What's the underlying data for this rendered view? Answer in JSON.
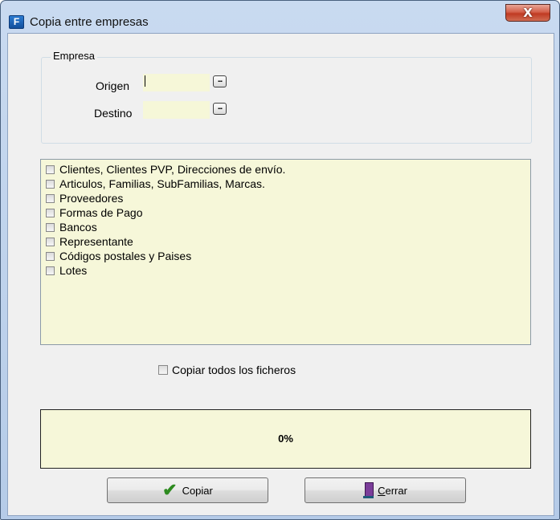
{
  "window": {
    "title": "Copia entre empresas",
    "close_glyph": "X",
    "app_icon_glyph": "F"
  },
  "empresa": {
    "group_label": "Empresa",
    "origen_label": "Origen",
    "origen_value": "",
    "destino_label": "Destino",
    "destino_value": "",
    "browse_glyph": "..."
  },
  "items": [
    {
      "label": "Clientes, Clientes PVP, Direcciones de envío.",
      "checked": false
    },
    {
      "label": "Articulos, Familias, SubFamilias, Marcas.",
      "checked": false
    },
    {
      "label": "Proveedores",
      "checked": false
    },
    {
      "label": "Formas de Pago",
      "checked": false
    },
    {
      "label": "Bancos",
      "checked": false
    },
    {
      "label": "Representante",
      "checked": false
    },
    {
      "label": "Códigos postales y Paises",
      "checked": false
    },
    {
      "label": "Lotes",
      "checked": false
    }
  ],
  "copy_all": {
    "label": "Copiar todos los ficheros",
    "checked": false
  },
  "progress": {
    "value": 0,
    "text": "0%"
  },
  "buttons": {
    "copiar": "Copiar",
    "cerrar_accel": "C",
    "cerrar_rest": "errar"
  },
  "colors": {
    "field_bg": "#f6f7d8",
    "list_bg": "#f6f7d9",
    "close_red": "#c03a22",
    "check_green": "#2d8a1f"
  }
}
